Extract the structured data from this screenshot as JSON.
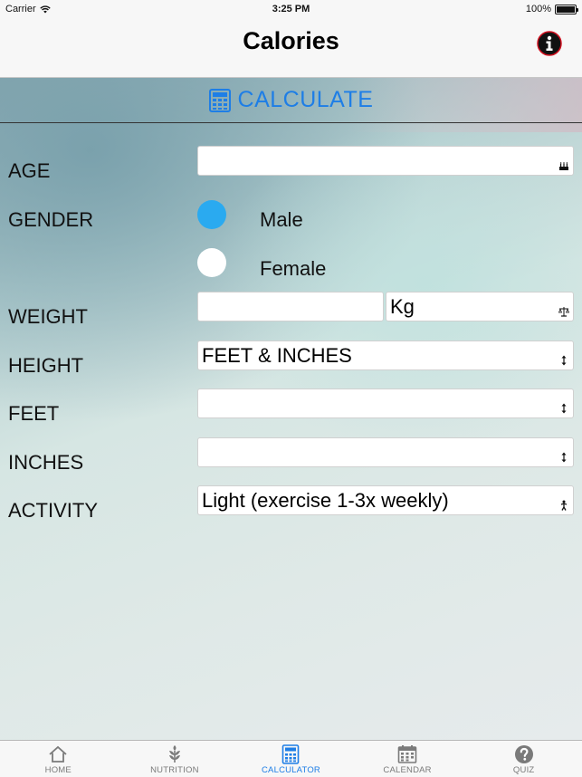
{
  "status": {
    "carrier": "Carrier",
    "time": "3:25 PM",
    "battery": "100%"
  },
  "nav": {
    "title": "Calories",
    "info_icon": "info-icon"
  },
  "calculate": {
    "label": "CALCULATE",
    "icon": "calculator-icon",
    "color": "#1e7ee6"
  },
  "form": {
    "age": {
      "label": "AGE",
      "value": ""
    },
    "gender": {
      "label": "GENDER",
      "options": [
        "Male",
        "Female"
      ],
      "selected": "Male",
      "accent": "#2aaaf0"
    },
    "weight": {
      "label": "WEIGHT",
      "value": "",
      "unit": "Kg"
    },
    "height": {
      "label": "HEIGHT",
      "value": "FEET & INCHES"
    },
    "feet": {
      "label": "FEET",
      "value": ""
    },
    "inches": {
      "label": "INCHES",
      "value": ""
    },
    "activity": {
      "label": "ACTIVITY",
      "value": "Light (exercise 1-3x weekly)"
    }
  },
  "tabs": [
    {
      "label": "HOME",
      "icon": "home-icon",
      "active": false
    },
    {
      "label": "NUTRITION",
      "icon": "leaf-icon",
      "active": false
    },
    {
      "label": "CALCULATOR",
      "icon": "calculator-icon",
      "active": true
    },
    {
      "label": "CALENDAR",
      "icon": "calendar-icon",
      "active": false
    },
    {
      "label": "QUIZ",
      "icon": "question-icon",
      "active": false
    }
  ]
}
